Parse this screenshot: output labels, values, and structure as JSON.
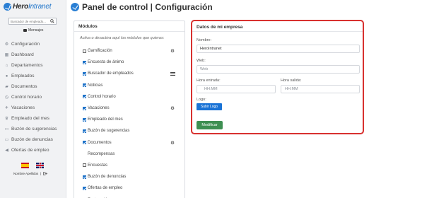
{
  "brand": {
    "name_main": "Hero",
    "name_accent": "Intranet"
  },
  "sidebar": {
    "search_placeholder": "Buscador de empleado...",
    "messages_label": "Mensajes",
    "items": [
      {
        "label": "Configuración",
        "icon": "gear-icon"
      },
      {
        "label": "Dashboard",
        "icon": "dashboard-icon"
      },
      {
        "label": "Departamentos",
        "icon": "departments-icon"
      },
      {
        "label": "Empleados",
        "icon": "user-icon"
      },
      {
        "label": "Documentos",
        "icon": "folder-icon"
      },
      {
        "label": "Control horario",
        "icon": "clock-icon"
      },
      {
        "label": "Vacaciones",
        "icon": "plane-icon"
      },
      {
        "label": "Empleado del mes",
        "icon": "trophy-icon"
      },
      {
        "label": "Buzón de sugerencias",
        "icon": "inbox-icon"
      },
      {
        "label": "Buzón de denuncias",
        "icon": "inbox-icon"
      },
      {
        "label": "Ofertas de empleo",
        "icon": "megaphone-icon"
      }
    ],
    "user_name": "Nombre Apellidos",
    "separator": "|"
  },
  "header": {
    "title": "Panel de control | Configuración"
  },
  "modules": {
    "title": "Módulos",
    "hint": "Activa o desactiva aquí los módulos que quieras:",
    "items": [
      {
        "label": "Gamificación",
        "checked": false,
        "indent": false,
        "icon": "gear-icon"
      },
      {
        "label": "Encuesta de ánimo",
        "checked": true,
        "indent": false,
        "icon": ""
      },
      {
        "label": "Buscador de empleados",
        "checked": true,
        "indent": false,
        "icon": "list-icon"
      },
      {
        "label": "Noticias",
        "checked": true,
        "indent": false,
        "icon": ""
      },
      {
        "label": "Control horario",
        "checked": true,
        "indent": false,
        "icon": ""
      },
      {
        "label": "Vacaciones",
        "checked": true,
        "indent": false,
        "icon": "gear-icon"
      },
      {
        "label": "Empleado del mes",
        "checked": true,
        "indent": false,
        "icon": ""
      },
      {
        "label": "Buzón de sugerencias",
        "checked": true,
        "indent": false,
        "icon": ""
      },
      {
        "label": "Documentos",
        "checked": true,
        "indent": false,
        "icon": "gear-icon"
      },
      {
        "label": "Recompensas",
        "checked": false,
        "indent": true,
        "icon": ""
      },
      {
        "label": "Encuestas",
        "checked": false,
        "indent": false,
        "icon": ""
      },
      {
        "label": "Buzón de denuncias",
        "checked": true,
        "indent": false,
        "icon": ""
      },
      {
        "label": "Ofertas de empleo",
        "checked": true,
        "indent": false,
        "icon": ""
      },
      {
        "label": "Facturación",
        "checked": false,
        "indent": false,
        "icon": "gear-icon"
      }
    ]
  },
  "company": {
    "title": "Datos de mi empresa",
    "name_label": "Nombre:",
    "name_value": "HeroIntranet",
    "web_label": "Web:",
    "web_placeholder": "Web",
    "entry_label": "Hora entrada:",
    "entry_placeholder": "HH:MM",
    "exit_label": "Hora salida:",
    "exit_placeholder": "HH:MM",
    "logo_label": "Logo:",
    "upload_label": "Subir Logo",
    "submit_label": "Modificar"
  },
  "colors": {
    "accent": "#1f73c9",
    "highlight_border": "#d8312f",
    "submit": "#3e8f52"
  }
}
